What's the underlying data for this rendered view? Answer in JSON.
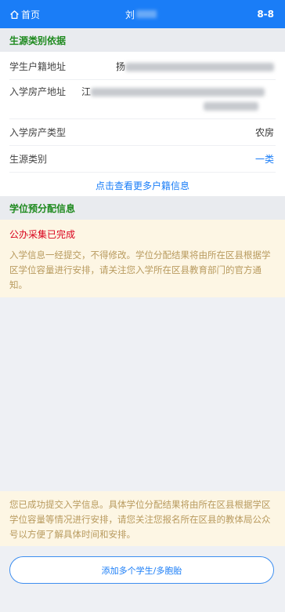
{
  "header": {
    "home_label": "首页",
    "title_char": "刘",
    "version": "8-8"
  },
  "source_section": {
    "title": "生源类别依据",
    "rows": [
      {
        "label": "学生户籍地址",
        "value_visible": "扬"
      },
      {
        "label": "入学房产地址",
        "value_visible": "江"
      },
      {
        "label": "入学房产类型",
        "value": "农房"
      },
      {
        "label": "生源类别",
        "value": "一类"
      }
    ],
    "more_link": "点击查看更多户籍信息"
  },
  "allocation_section": {
    "title": "学位预分配信息",
    "status": "公办采集已完成",
    "message": "入学信息一经提交，不得修改。学位分配结果将由所在区县根据学区学位容量进行安排，请关注您入学所在区县教育部门的官方通知。"
  },
  "footer_notice": {
    "message": "您已成功提交入学信息。具体学位分配结果将由所在区县根据学区学位容量等情况进行安排，请您关注您报名所在区县的教体局公众号以方便了解具体时间和安排。"
  },
  "add_button_label": "添加多个学生/多胞胎",
  "colors": {
    "header_bg": "#1a7df7",
    "section_title": "#1f8a1f",
    "status_red": "#d9001b",
    "notice_bg": "#fdf6e4",
    "link_blue": "#1a7df7"
  }
}
